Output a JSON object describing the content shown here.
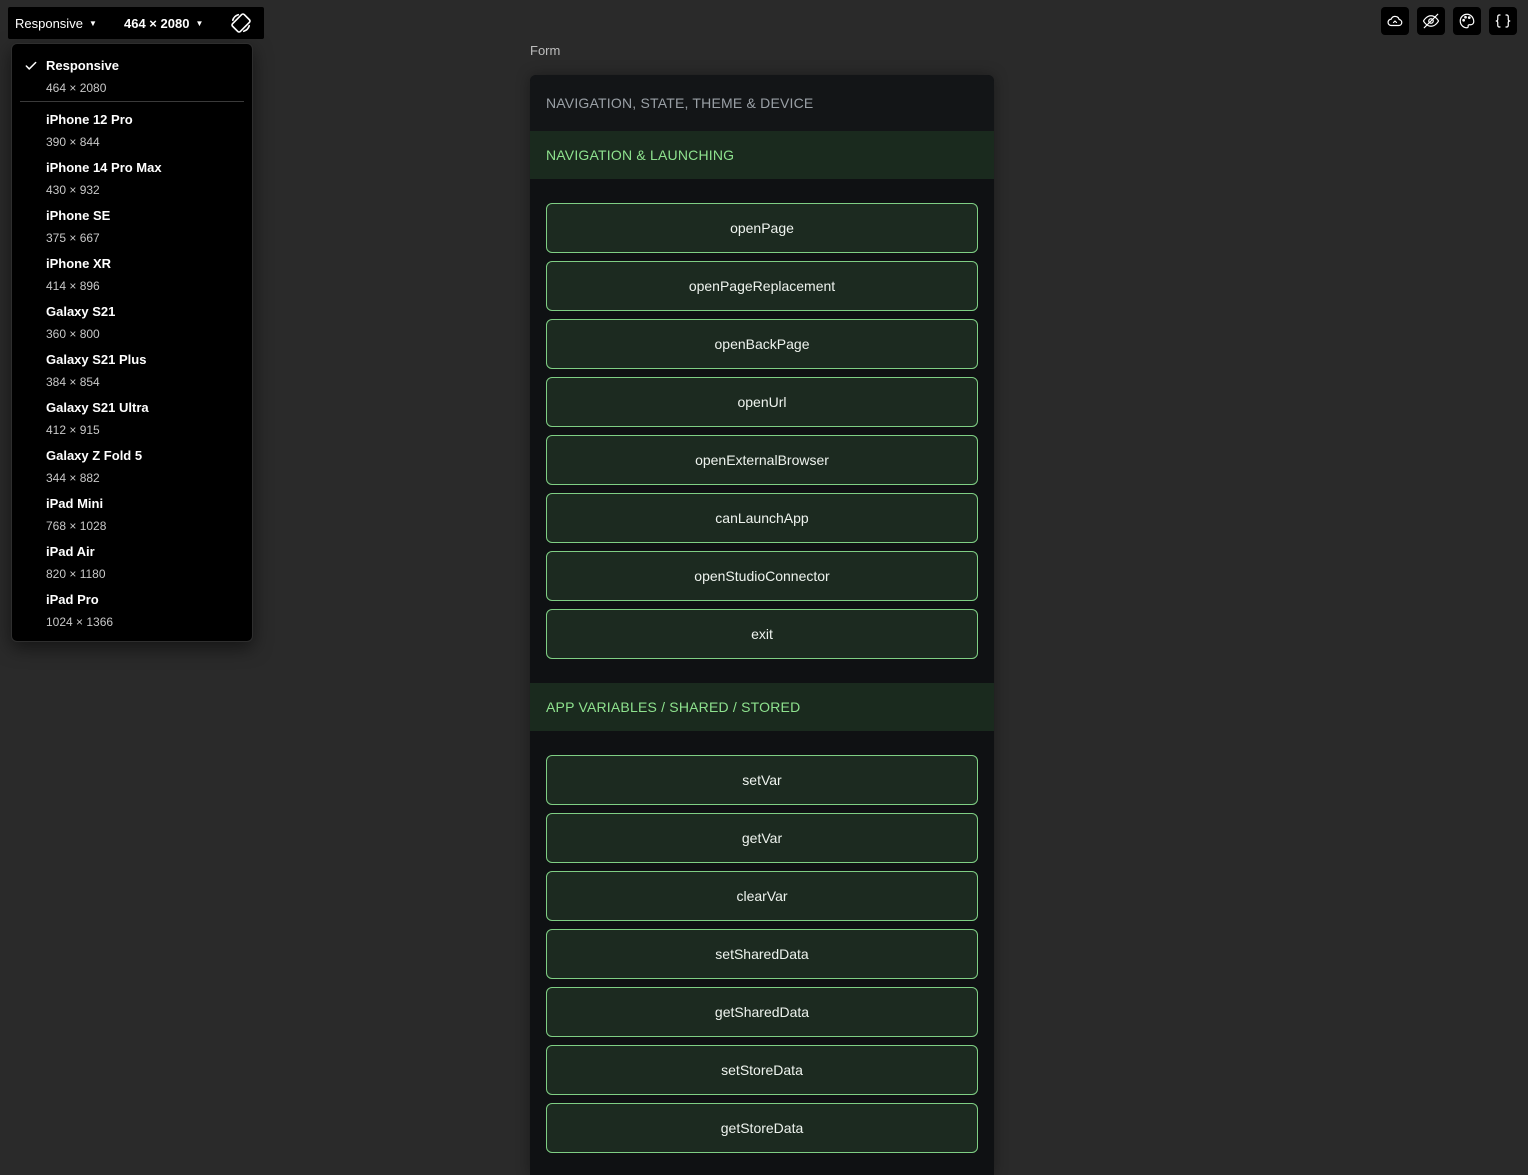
{
  "toolbar": {
    "device_select": "Responsive",
    "size_select": "464 × 2080",
    "rotate_icon": "rotate-icon"
  },
  "device_menu": {
    "items": [
      {
        "name": "Responsive",
        "dims": "464 × 2080",
        "selected": true
      },
      {
        "name": "iPhone 12 Pro",
        "dims": "390 × 844"
      },
      {
        "name": "iPhone 14 Pro Max",
        "dims": "430 × 932"
      },
      {
        "name": "iPhone SE",
        "dims": "375 × 667"
      },
      {
        "name": "iPhone XR",
        "dims": "414 × 896"
      },
      {
        "name": "Galaxy S21",
        "dims": "360 × 800"
      },
      {
        "name": "Galaxy S21 Plus",
        "dims": "384 × 854"
      },
      {
        "name": "Galaxy S21 Ultra",
        "dims": "412 × 915"
      },
      {
        "name": "Galaxy Z Fold 5",
        "dims": "344 × 882"
      },
      {
        "name": "iPad Mini",
        "dims": "768 × 1028"
      },
      {
        "name": "iPad Air",
        "dims": "820 × 1180"
      },
      {
        "name": "iPad Pro",
        "dims": "1024 × 1366"
      }
    ]
  },
  "top_right_icons": [
    "cloud-icon",
    "eye-off-icon",
    "palette-icon",
    "braces-icon"
  ],
  "preview": {
    "form_label": "Form",
    "title": "NAVIGATION, STATE, THEME & DEVICE",
    "sections": [
      {
        "title": "NAVIGATION & LAUNCHING",
        "buttons": [
          "openPage",
          "openPageReplacement",
          "openBackPage",
          "openUrl",
          "openExternalBrowser",
          "canLaunchApp",
          "openStudioConnector",
          "exit"
        ]
      },
      {
        "title": "APP VARIABLES / SHARED / STORED",
        "buttons": [
          "setVar",
          "getVar",
          "clearVar",
          "setSharedData",
          "getSharedData",
          "setStoreData",
          "getStoreData"
        ]
      }
    ]
  },
  "colors": {
    "canvas_bg": "#2a2a2a",
    "accent_green": "#8ee28e",
    "button_border": "#7fcf84",
    "button_bg": "#1c2a20"
  }
}
